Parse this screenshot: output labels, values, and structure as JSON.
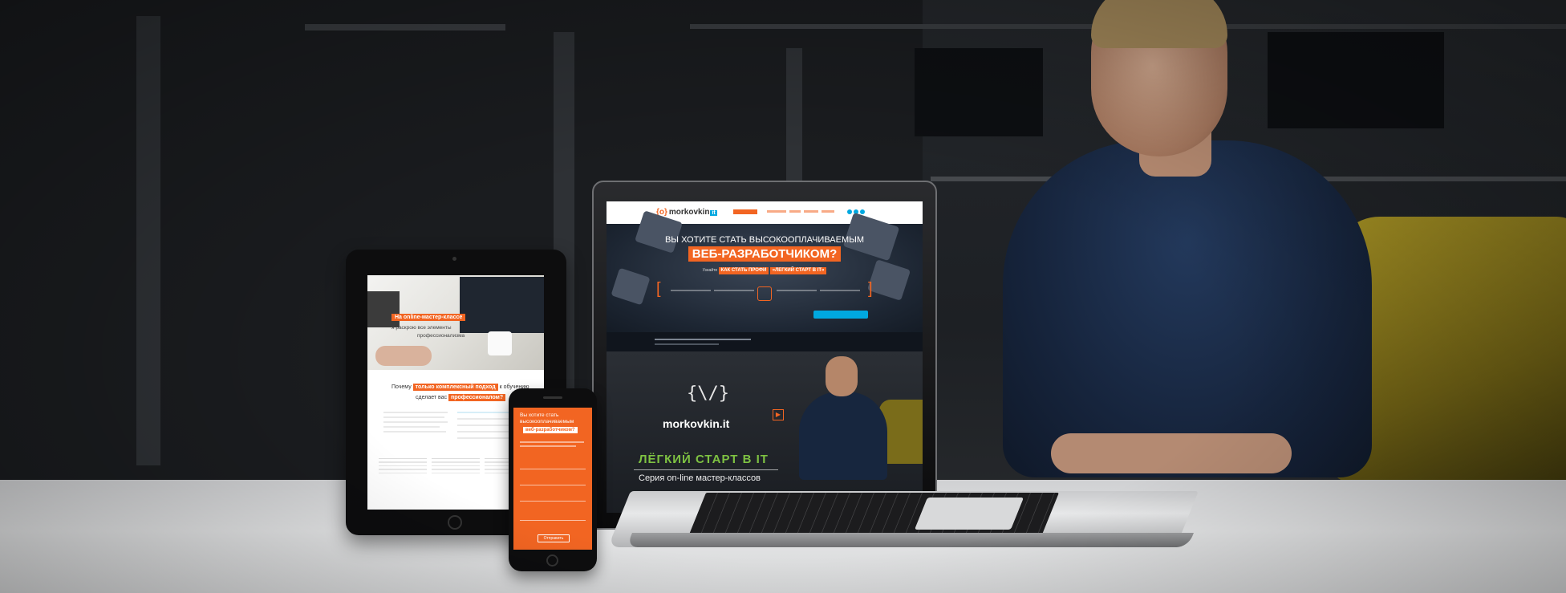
{
  "tablet": {
    "hero_tag": "На online-мастер-классе",
    "hero_line1": "я раскрою все элементы",
    "hero_line2": "профессионализма",
    "why_prefix": "Почему",
    "why_highlight": "только комплексный подход",
    "why_suffix": "к обучению",
    "why_line2_prefix": "сделает вас",
    "why_line2_highlight": "профессионалом?"
  },
  "phone": {
    "title": "Вы хотите стать высокооплачиваемым",
    "badge": "веб-разработчиком?",
    "submit_label": "Отправить"
  },
  "laptop": {
    "logo_text": "morkovkin",
    "logo_suffix": "it",
    "logo_mark": "{o}",
    "hero_line1": "ВЫ ХОТИТЕ СТАТЬ ВЫСОКООПЛАЧИВАЕМЫМ",
    "hero_line2": "ВЕБ-РАЗРАБОТЧИКОМ?",
    "sub_prefix": "Узнайте",
    "sub_badge1": "КАК СТАТЬ ПРОФИ",
    "sub_badge2": "«ЛЕГКИЙ СТАРТ В IT»",
    "video_logo": "{\\/}",
    "video_name": "morkovkin.it",
    "video_play": "▶",
    "video_title": "ЛЁГКИЙ СТАРТ В IT",
    "video_subtitle": "Серия on-line мастер-классов"
  },
  "colors": {
    "accent_orange": "#f26522",
    "accent_blue": "#00a8e0",
    "accent_green": "#7ec242"
  }
}
